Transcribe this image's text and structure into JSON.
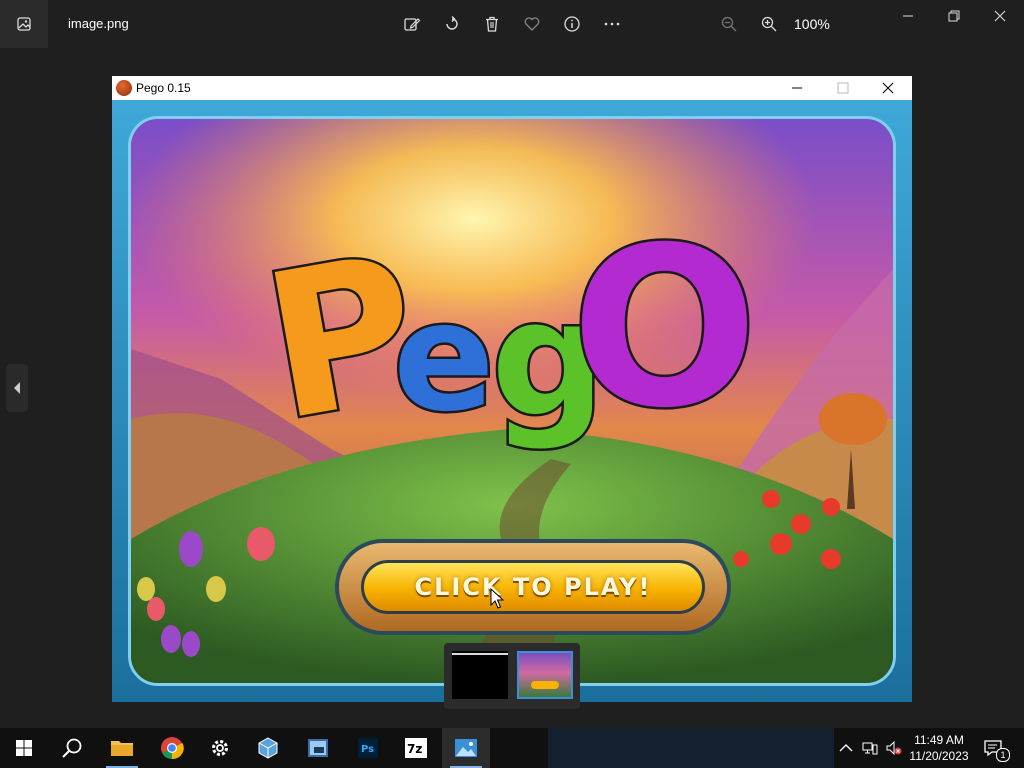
{
  "viewer": {
    "file_name": "image.png",
    "zoom_level": "100%",
    "toolbar_icons": [
      "edit-image-icon",
      "rotate-icon",
      "delete-icon",
      "favorite-icon",
      "info-icon",
      "more-icon",
      "zoom-out-icon",
      "zoom-in-icon"
    ]
  },
  "game_window": {
    "title": "Pego 0.15",
    "play_button_label": "CLICK TO PLAY!",
    "logo_letters": [
      {
        "char": "P",
        "color": "#f59a1c"
      },
      {
        "char": "e",
        "color": "#2f6fd8"
      },
      {
        "char": "g",
        "color": "#5cc22a"
      },
      {
        "char": "O",
        "color": "#b22ad0"
      }
    ]
  },
  "thumbnails": [
    {
      "name": "black-screen"
    },
    {
      "name": "pego-title",
      "selected": true
    }
  ],
  "taskbar": {
    "apps": [
      "start",
      "search",
      "file-explorer",
      "chrome",
      "settings",
      "virtualbox",
      "cinebench",
      "photoshop",
      "7zip",
      "photos"
    ],
    "time": "11:49 AM",
    "date": "11/20/2023",
    "notification_count": "1"
  }
}
